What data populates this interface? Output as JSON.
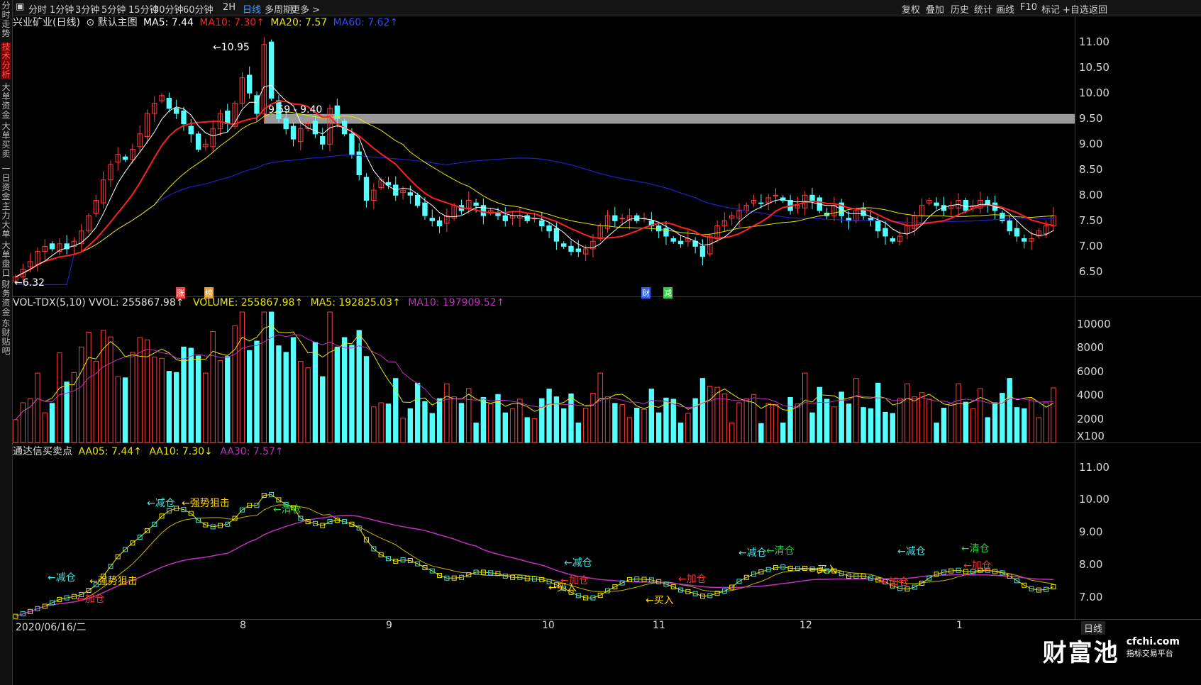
{
  "left_tabs": [
    "分时走势",
    "技术分析",
    "大单资金",
    "大单买卖",
    "一日资金",
    "主力大单",
    "大单盘口",
    "财务资金",
    "东财贴吧"
  ],
  "toolbar": {
    "periods": [
      "分时",
      "1分钟",
      "3分钟",
      "5分钟",
      "15分钟",
      "30分钟",
      "60分钟",
      "2H",
      "日线",
      "多周期",
      "更多 >"
    ],
    "active": "日线",
    "right": [
      "复权",
      "叠加",
      "历史",
      "统计",
      "画线",
      "F10",
      "标记",
      "+自选",
      "返回"
    ]
  },
  "main_legend": {
    "title": "兴业矿业(日线)",
    "template": "默认主图",
    "ma5": "MA5: 7.44",
    "ma10": "MA10: 7.30↑",
    "ma20": "MA20: 7.57",
    "ma60": "MA60: 7.62↑"
  },
  "vol_legend": {
    "vvol": "VOL-TDX(5,10) VVOL: 255867.98↑",
    "volume": "VOLUME: 255867.98↑",
    "ma5": "MA5: 192825.03↑",
    "ma10": "MA10: 197909.52↑"
  },
  "ind_legend": {
    "name": "通达信买卖点",
    "aa05": "AA05: 7.44↑",
    "aa10": "AA10: 7.30↓",
    "aa30": "AA30: 7.57↑"
  },
  "price_axis": [
    "11.00",
    "10.50",
    "10.00",
    "9.50",
    "9.00",
    "8.50",
    "8.00",
    "7.50",
    "7.00",
    "6.50"
  ],
  "vol_axis": [
    "10000",
    "8000",
    "6000",
    "4000",
    "2000"
  ],
  "vol_unit": "X100",
  "ind_axis": [
    "11.00",
    "10.00",
    "9.00",
    "8.00",
    "7.00"
  ],
  "date_axis": {
    "start": "2020/06/16/二",
    "months": [
      "8",
      "9",
      "10",
      "11",
      "12",
      "1"
    ],
    "period": "日线"
  },
  "price_annotations": {
    "high": "10.95",
    "low": "6.32",
    "zone": "9.59 - 9.40",
    "badges": [
      "涨",
      "榜",
      "财",
      "减"
    ]
  },
  "signals": [
    {
      "text": "←减仓",
      "color": "#45e0e0"
    },
    {
      "text": "←强势狙击",
      "color": "#ffd700"
    },
    {
      "text": "←清仓",
      "color": "#2ecc40"
    },
    {
      "text": "←减仓",
      "color": "#45e0e0"
    },
    {
      "text": "←强势狙击",
      "color": "#ffd700"
    },
    {
      "text": "←加仓",
      "color": "#ff3030"
    },
    {
      "text": "←减仓",
      "color": "#45e0e0"
    },
    {
      "text": "←买入",
      "color": "#ffd700"
    },
    {
      "text": "←加仓",
      "color": "#ff3030"
    },
    {
      "text": "←买入",
      "color": "#ffd700"
    },
    {
      "text": "←加仓",
      "color": "#ff3030"
    },
    {
      "text": "←减仓",
      "color": "#45e0e0"
    },
    {
      "text": "←清仓",
      "color": "#2ecc40"
    },
    {
      "text": "←买入",
      "color": "#ffd700"
    },
    {
      "text": "←减仓",
      "color": "#45e0e0"
    },
    {
      "text": "←清仓",
      "color": "#2ecc40"
    },
    {
      "text": "←加仓",
      "color": "#ff3030"
    },
    {
      "text": "←加仓",
      "color": "#ff3030"
    }
  ],
  "watermark": {
    "brand": "财富池",
    "url": "cfchi.com",
    "tagline": "指标交易平台"
  },
  "colors": {
    "up": "#ff3b3b",
    "down": "#54ffff",
    "ma5": "#ffffff",
    "ma10": "#ff2020",
    "ma20": "#e8e800",
    "ma60": "#2020c8",
    "vol_ma10": "#c030c0"
  },
  "chart_data": {
    "type": "candlestick",
    "title": "兴业矿业(日线)",
    "price_ylim": [
      6.2,
      11.1
    ],
    "x_months": [
      "8",
      "9",
      "10",
      "11",
      "12",
      "1"
    ],
    "close_series": [
      6.4,
      6.55,
      6.7,
      6.9,
      7.0,
      6.95,
      7.05,
      6.95,
      7.1,
      7.3,
      7.6,
      7.9,
      8.3,
      8.6,
      8.8,
      8.7,
      8.9,
      9.2,
      9.6,
      9.8,
      9.95,
      9.7,
      9.6,
      9.4,
      9.2,
      8.9,
      9.0,
      9.3,
      9.6,
      9.4,
      9.8,
      10.3,
      10.0,
      9.6,
      10.95,
      9.9,
      9.5,
      9.3,
      9.1,
      9.3,
      9.4,
      9.2,
      9.0,
      9.7,
      9.5,
      9.2,
      8.8,
      8.4,
      7.9,
      8.1,
      8.3,
      8.2,
      8.0,
      8.1,
      8.0,
      7.8,
      7.6,
      7.5,
      7.4,
      7.6,
      7.8,
      7.7,
      7.9,
      7.8,
      7.6,
      7.7,
      7.6,
      7.5,
      7.6,
      7.6,
      7.5,
      7.55,
      7.4,
      7.3,
      7.1,
      7.0,
      6.9,
      6.9,
      6.95,
      7.1,
      7.4,
      7.6,
      7.5,
      7.55,
      7.6,
      7.5,
      7.55,
      7.4,
      7.3,
      7.2,
      7.1,
      7.05,
      7.15,
      7.0,
      6.8,
      7.2,
      7.4,
      7.5,
      7.6,
      7.7,
      7.8,
      7.9,
      7.85,
      7.95,
      8.0,
      7.9,
      7.7,
      7.8,
      8.0,
      7.9,
      7.7,
      7.6,
      7.8,
      7.6,
      7.5,
      7.7,
      7.6,
      7.5,
      7.3,
      7.2,
      7.1,
      7.2,
      7.4,
      7.6,
      7.8,
      7.9,
      7.8,
      7.7,
      7.8,
      7.9,
      7.7,
      7.8,
      7.9,
      7.8,
      7.7,
      7.5,
      7.3,
      7.2,
      7.1,
      7.15,
      7.3,
      7.4,
      7.6
    ],
    "vol_ylim": [
      0,
      11000
    ],
    "ind_ylim": [
      6.6,
      11.3
    ]
  }
}
